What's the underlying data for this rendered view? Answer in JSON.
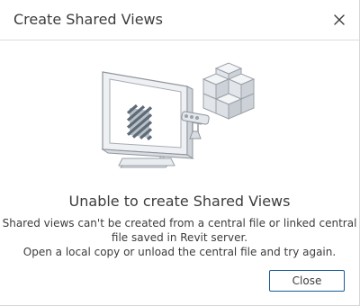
{
  "dialog": {
    "title": "Create Shared Views",
    "heading": "Unable to create Shared Views",
    "message_lines": [
      "Shared views can't be created from a central file or linked central",
      "file saved in Revit server.",
      "Open a local copy or unload the central file and try again."
    ],
    "close_button_label": "Close"
  },
  "icons": {
    "close": "close-icon",
    "illustration": "monitor-disconnected-server-illustration"
  },
  "colors": {
    "button_border": "#1a5c98",
    "text": "#3c3c3c",
    "divider": "#dcdcdc"
  }
}
